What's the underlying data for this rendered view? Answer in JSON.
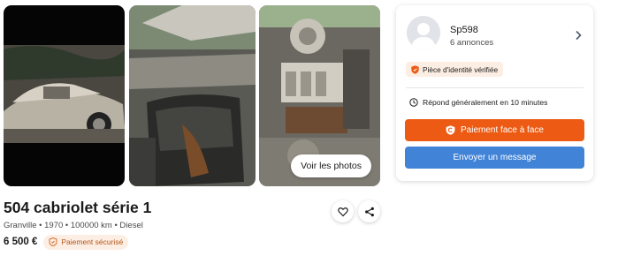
{
  "gallery": {
    "photos": [
      {
        "icon": "car-exterior-photo"
      },
      {
        "icon": "car-interior-seats-photo"
      },
      {
        "icon": "car-engine-photo"
      }
    ],
    "see_photos_label": "Voir les photos"
  },
  "ad": {
    "title": "504 cabriolet série 1",
    "subtitle": "Granville • 1970 • 100000 km • Diesel",
    "price": "6 500 €",
    "secure_payment_label": "Paiement sécurisé"
  },
  "actions": {
    "favorite_icon": "heart-icon",
    "share_icon": "share-icon"
  },
  "seller": {
    "name": "Sp598",
    "ads_count": "6 annonces",
    "id_verified_label": "Pièce d'identité vérifiée",
    "response_time": "Répond généralement en 10 minutes",
    "pay_button_label": "Paiement face à face",
    "message_button_label": "Envoyer un message"
  },
  "colors": {
    "accent_orange": "#ec5a13",
    "accent_blue": "#4183d7",
    "badge_bg": "#fdeee4"
  }
}
